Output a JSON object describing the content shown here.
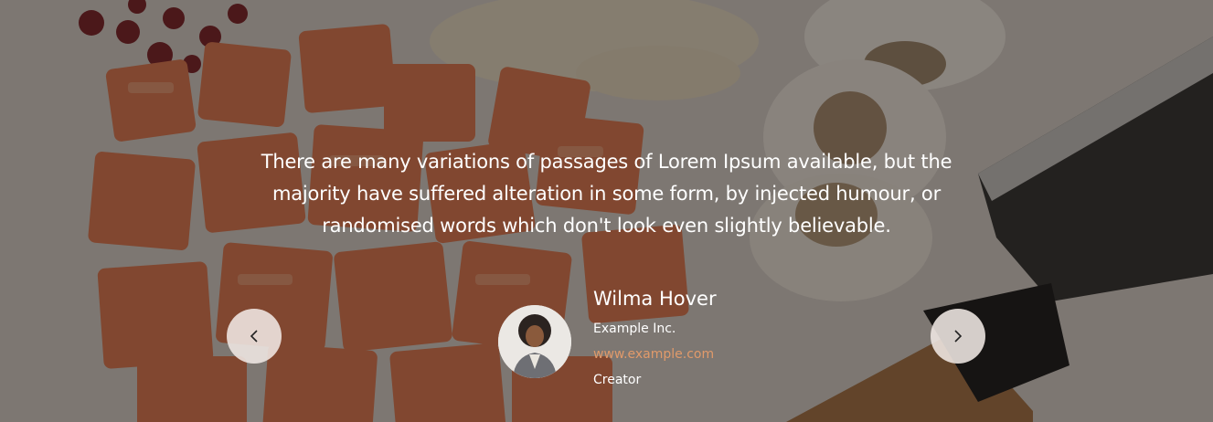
{
  "testimonial": {
    "quote": "There are many variations of passages of Lorem Ipsum available, but the majority have suffered alteration in some form, by injected humour, or randomised words which don't look even slightly believable.",
    "author_name": "Wilma Hover",
    "company": "Example Inc.",
    "website": "www.example.com",
    "role": "Creator"
  },
  "navigation": {
    "prev_icon": "chevron-left-icon",
    "next_icon": "chevron-right-icon"
  },
  "colors": {
    "overlay": "#19141270",
    "link": "#e19a6a",
    "nav_button": "#f0e8e4"
  }
}
